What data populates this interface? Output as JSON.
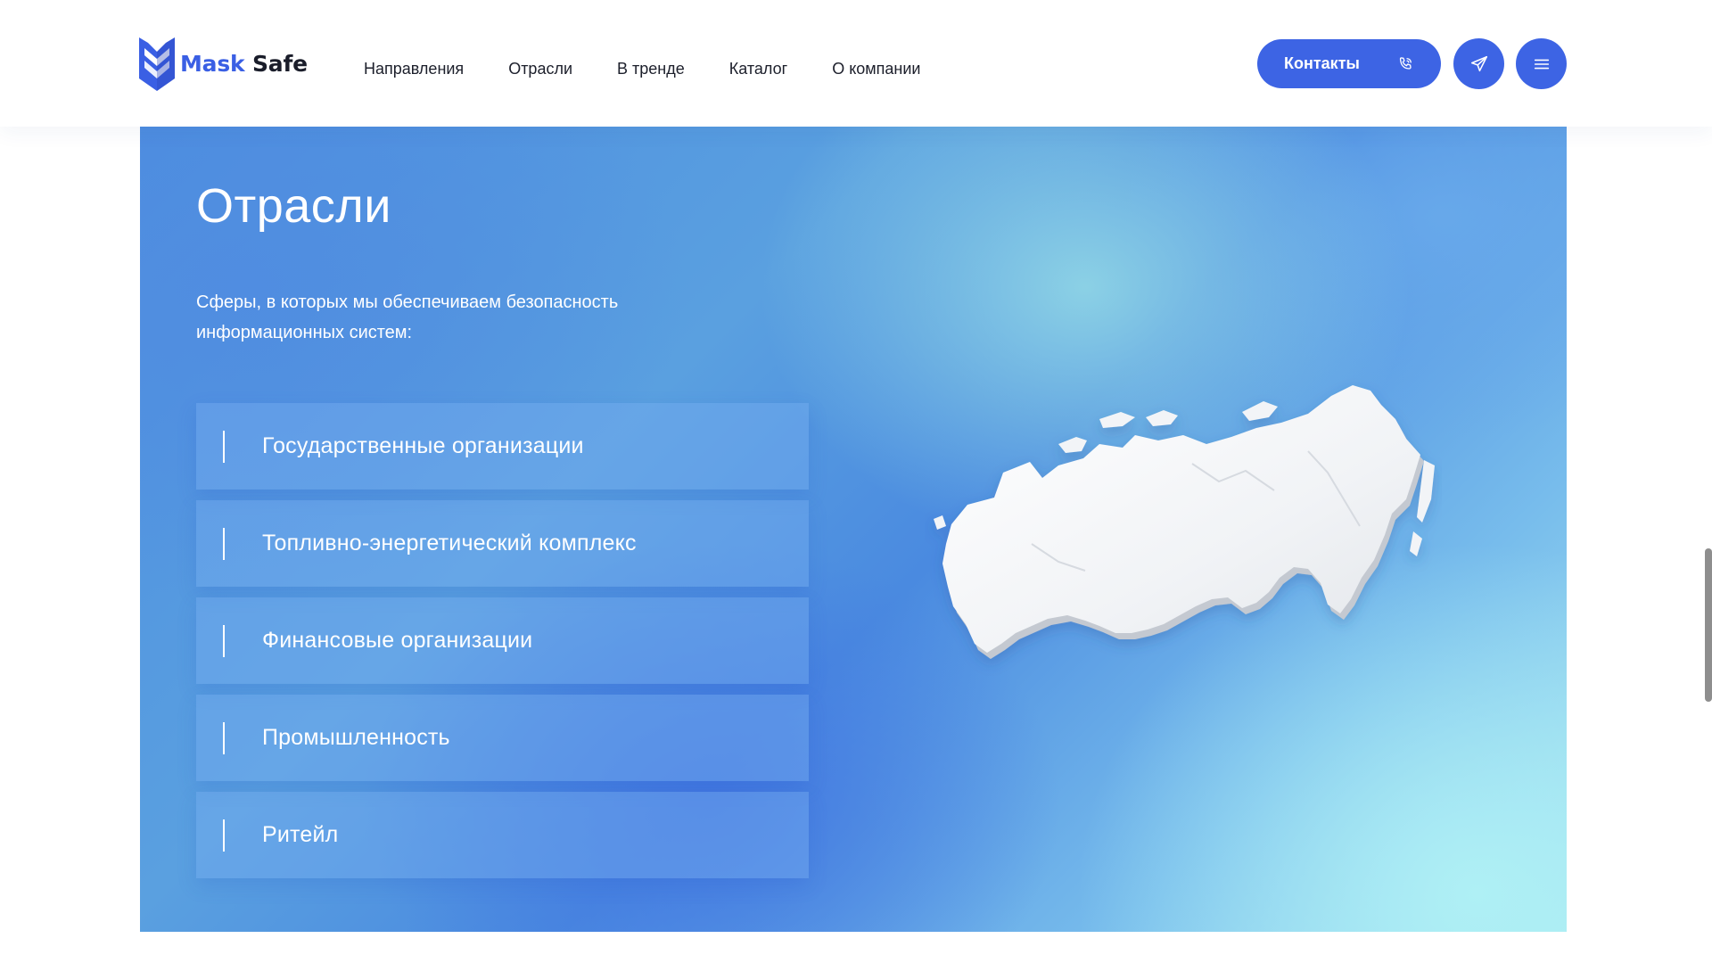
{
  "header": {
    "logo": {
      "word1": "Mask",
      "word2": "Safe"
    },
    "nav": [
      {
        "label": "Направления"
      },
      {
        "label": "Отрасли"
      },
      {
        "label": "В тренде"
      },
      {
        "label": "Каталог"
      },
      {
        "label": "О компании"
      }
    ],
    "contacts_label": "Контакты",
    "icons": {
      "contacts": "phone-icon",
      "send": "paper-plane-icon",
      "menu": "hamburger-menu-icon"
    }
  },
  "hero": {
    "title": "Отрасли",
    "subtitle": "Сферы, в которых мы обеспечиваем безопасность информационных систем:",
    "industries": [
      {
        "label": "Государственные организации"
      },
      {
        "label": "Топливно-энергетический комплекс"
      },
      {
        "label": "Финансовые организации"
      },
      {
        "label": "Промышленность"
      },
      {
        "label": "Ритейл"
      }
    ]
  },
  "colors": {
    "accent": "#3d64e4",
    "brand_blue": "#3a5fe4",
    "text_dark": "#1c1f2b",
    "hero_base": "#4c8ddf",
    "hero_light": "#a8e6f2"
  }
}
